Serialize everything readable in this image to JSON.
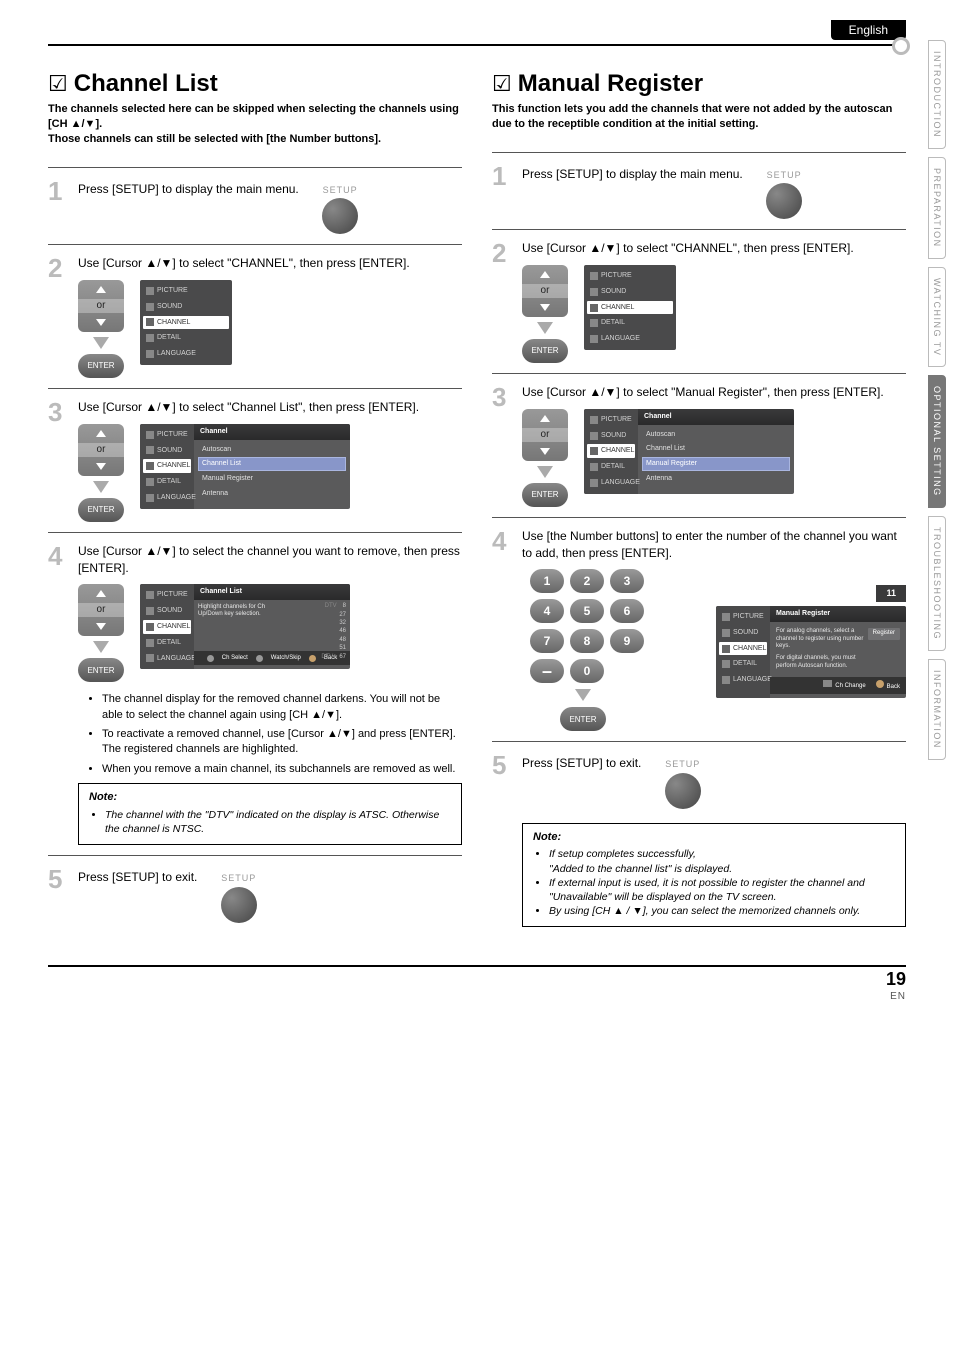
{
  "header": {
    "language": "English"
  },
  "sideTabs": {
    "t1": "INTRODUCTION",
    "t2": "PREPARATION",
    "t3": "WATCHING  TV",
    "t4": "OPTIONAL  SETTING",
    "t5": "TROUBLESHOOTING",
    "t6": "INFORMATION"
  },
  "left": {
    "title": "Channel List",
    "desc": " The channels selected here can be skipped when selecting the channels using [CH ▲/▼].\nThose channels can still be selected with [the Number buttons].",
    "step1": {
      "text": "Press [SETUP] to display the main menu.",
      "btn": "SETUP"
    },
    "step2": {
      "text": "Use [Cursor ▲/▼] to select \"CHANNEL\", then press [ENTER].",
      "or": "or",
      "enter": "ENTER",
      "osd": {
        "items": [
          "PICTURE",
          "SOUND",
          "CHANNEL",
          "DETAIL",
          "LANGUAGE"
        ],
        "selIndex": 2
      }
    },
    "step3": {
      "text": "Use [Cursor ▲/▼] to select \"Channel List\", then press [ENTER].",
      "or": "or",
      "enter": "ENTER",
      "osd": {
        "header": "Channel",
        "side": [
          "PICTURE",
          "SOUND",
          "CHANNEL",
          "DETAIL",
          "LANGUAGE"
        ],
        "sideSel": 2,
        "list": [
          "Autoscan",
          "Channel List",
          "Manual Register",
          "Antenna"
        ],
        "listSel": 1
      }
    },
    "step4": {
      "text": "Use [Cursor ▲/▼] to select the channel you want to remove, then press [ENTER].",
      "or": "or",
      "enter": "ENTER",
      "osd": {
        "header": "Channel List",
        "side": [
          "PICTURE",
          "SOUND",
          "CHANNEL",
          "DETAIL",
          "LANGUAGE"
        ],
        "sideSel": 2,
        "desc": "Highlight channels for Ch Up/Down key selection.",
        "rows": [
          [
            "DTV",
            "8"
          ],
          [
            "",
            "27"
          ],
          [
            "",
            "32"
          ],
          [
            "",
            "46"
          ],
          [
            "",
            "48"
          ],
          [
            "",
            "51"
          ],
          [
            "DTV",
            "67"
          ]
        ],
        "footer": {
          "a": "Ch Select",
          "b": "Watch/Skip",
          "c": "Back"
        }
      }
    },
    "bullets": [
      "The channel display for the removed channel darkens. You will not be able to select the channel again using [CH ▲/▼].",
      "To reactivate a removed channel, use [Cursor ▲/▼] and press [ENTER]. The registered channels are highlighted.",
      "When you remove a main channel, its subchannels are removed as well."
    ],
    "note": {
      "title": "Note:",
      "items": [
        "The channel with the \"DTV\" indicated on the display is ATSC. Otherwise the channel is NTSC."
      ]
    },
    "step5": {
      "text": "Press [SETUP] to exit.",
      "btn": "SETUP"
    }
  },
  "right": {
    "title": "Manual Register",
    "desc": "This function lets you add the channels that were not added by the autoscan due to the receptible condition at the initial setting.",
    "step1": {
      "text": "Press [SETUP] to display the main menu.",
      "btn": "SETUP"
    },
    "step2": {
      "text": "Use [Cursor ▲/▼] to select \"CHANNEL\", then press [ENTER].",
      "or": "or",
      "enter": "ENTER",
      "osd": {
        "items": [
          "PICTURE",
          "SOUND",
          "CHANNEL",
          "DETAIL",
          "LANGUAGE"
        ],
        "selIndex": 2
      }
    },
    "step3": {
      "text": "Use [Cursor ▲/▼] to select \"Manual Register\", then press [ENTER].",
      "or": "or",
      "enter": "ENTER",
      "osd": {
        "header": "Channel",
        "side": [
          "PICTURE",
          "SOUND",
          "CHANNEL",
          "DETAIL",
          "LANGUAGE"
        ],
        "sideSel": 2,
        "list": [
          "Autoscan",
          "Channel List",
          "Manual Register",
          "Antenna"
        ],
        "listSel": 2
      }
    },
    "step4": {
      "text": "Use [the Number buttons] to enter the number of the channel you want to add, then press [ENTER].",
      "keys": [
        "1",
        "2",
        "3",
        "4",
        "5",
        "6",
        "7",
        "8",
        "9",
        "–",
        "0"
      ],
      "enter": "ENTER",
      "osd": {
        "header": "Manual Register",
        "side": [
          "PICTURE",
          "SOUND",
          "CHANNEL",
          "DETAIL",
          "LANGUAGE"
        ],
        "sideSel": 2,
        "lines": [
          "For analog channels, select a channel to register using number keys.",
          "For digital channels, you must perform Autoscan function."
        ],
        "registerBtn": "Register",
        "footer": {
          "a": "Ch Change",
          "b": "Back"
        }
      }
    },
    "step5": {
      "text": "Press [SETUP] to exit.",
      "btn": "SETUP"
    },
    "note": {
      "title": "Note:",
      "items": [
        "If setup completes successfully,\n\"Added to the channel list\" is displayed.",
        "If external input is used, it is not possible to register the channel and \"Unavailable\" will be displayed on the TV screen.",
        "By using [CH ▲ / ▼], you can select the memorized channels only."
      ]
    }
  },
  "footer": {
    "pageNum": "19",
    "lang": "EN",
    "colPage": "11"
  }
}
